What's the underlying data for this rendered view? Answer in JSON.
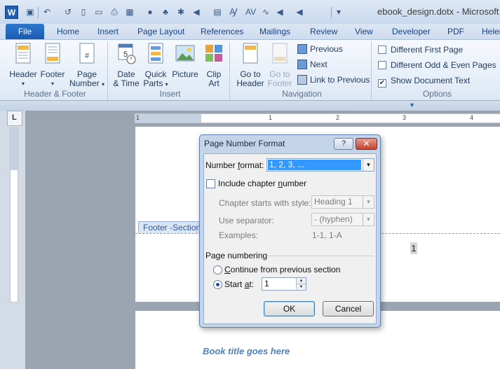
{
  "window": {
    "app_icon": "W",
    "title": "ebook_design.dotx - Microsoft W"
  },
  "quick_access": [
    "save-icon",
    "undo-icon",
    "redo-icon",
    "new-document-icon",
    "open-folder-icon",
    "print-icon",
    "page-layout-icon",
    "shapes-icon",
    "dropdown-icon"
  ],
  "ribbon_tabs": [
    {
      "label": "File"
    },
    {
      "label": "Home"
    },
    {
      "label": "Insert"
    },
    {
      "label": "Page Layout"
    },
    {
      "label": "References"
    },
    {
      "label": "Mailings"
    },
    {
      "label": "Review"
    },
    {
      "label": "View"
    },
    {
      "label": "Developer"
    },
    {
      "label": "PDF"
    },
    {
      "label": "Heler"
    }
  ],
  "ribbon": {
    "header_footer": {
      "label": "Header & Footer",
      "header": "Header",
      "footer": "Footer",
      "page_number_line1": "Page",
      "page_number_line2": "Number"
    },
    "insert": {
      "label": "Insert",
      "date_time_line1": "Date",
      "date_time_line2": "& Time",
      "quick_parts_line1": "Quick",
      "quick_parts_line2": "Parts",
      "picture": "Picture",
      "clip_art_line1": "Clip",
      "clip_art_line2": "Art"
    },
    "navigation": {
      "label": "Navigation",
      "goto_header_line1": "Go to",
      "goto_header_line2": "Header",
      "goto_footer_line1": "Go to",
      "goto_footer_line2": "Footer",
      "previous": "Previous",
      "next": "Next",
      "link_to_previous": "Link to Previous"
    },
    "options": {
      "label": "Options",
      "different_first_page": "Different First Page",
      "different_odd_even": "Different Odd & Even Pages",
      "show_document_text": "Show Document Text",
      "different_first_page_checked": false,
      "different_odd_even_checked": false,
      "show_document_text_checked": true
    }
  },
  "ruler": {
    "corner_glyph": "L",
    "numbers": [
      "1",
      "1",
      "2",
      "3",
      "4"
    ]
  },
  "document": {
    "footer_tag": "Footer -Section",
    "page_number": "1",
    "book_title": "Book title goes here"
  },
  "dialog": {
    "title": "Page Number Format",
    "help": "?",
    "close": "✕",
    "number_format_label_pre": "Number ",
    "number_format_label_acc": "f",
    "number_format_label_post": "ormat:",
    "number_format_value": "1, 2, 3, ...",
    "include_chapter_pre": "Include chapter ",
    "include_chapter_acc": "n",
    "include_chapter_post": "umber",
    "chapter_starts_label": "Chapter starts with style:",
    "chapter_starts_value": "Heading 1",
    "use_separator_label": "Use separator:",
    "use_separator_value": "-   (hyphen)",
    "examples_label": "Examples:",
    "examples_value": "1-1, 1-A",
    "page_numbering_label": "Page numbering",
    "continue_pre": "",
    "continue_acc": "C",
    "continue_post": "ontinue from previous section",
    "start_at_pre": "Start ",
    "start_at_acc": "a",
    "start_at_post": "t:",
    "start_at_value": "1",
    "ok": "OK",
    "cancel": "Cancel"
  }
}
